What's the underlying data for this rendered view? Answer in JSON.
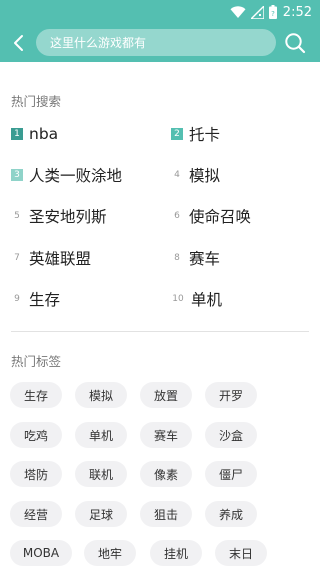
{
  "status_bar": {
    "time": "2:52",
    "icons": [
      "wifi-icon",
      "signal-icon",
      "battery-icon"
    ]
  },
  "header": {
    "search_placeholder": "这里什么游戏都有",
    "back_icon": "chevron-left-icon",
    "search_icon": "search-icon",
    "accent_color": "#54bfb1"
  },
  "hot_search": {
    "title": "热门搜索",
    "items": [
      {
        "rank": "1",
        "label": "nba"
      },
      {
        "rank": "2",
        "label": "托卡"
      },
      {
        "rank": "3",
        "label": "人类一败涂地"
      },
      {
        "rank": "4",
        "label": "模拟"
      },
      {
        "rank": "5",
        "label": "圣安地列斯"
      },
      {
        "rank": "6",
        "label": "使命召唤"
      },
      {
        "rank": "7",
        "label": "英雄联盟"
      },
      {
        "rank": "8",
        "label": "赛车"
      },
      {
        "rank": "9",
        "label": "生存"
      },
      {
        "rank": "10",
        "label": "单机"
      }
    ],
    "rank_colors": [
      "#3a9c92",
      "#54bfb1",
      "#8fd3c9"
    ]
  },
  "hot_tags": {
    "title": "热门标签",
    "tags": [
      "生存",
      "模拟",
      "放置",
      "开罗",
      "吃鸡",
      "单机",
      "赛车",
      "沙盒",
      "塔防",
      "联机",
      "像素",
      "僵尸",
      "经营",
      "足球",
      "狙击",
      "养成",
      "MOBA",
      "地牢",
      "挂机",
      "末日"
    ]
  }
}
